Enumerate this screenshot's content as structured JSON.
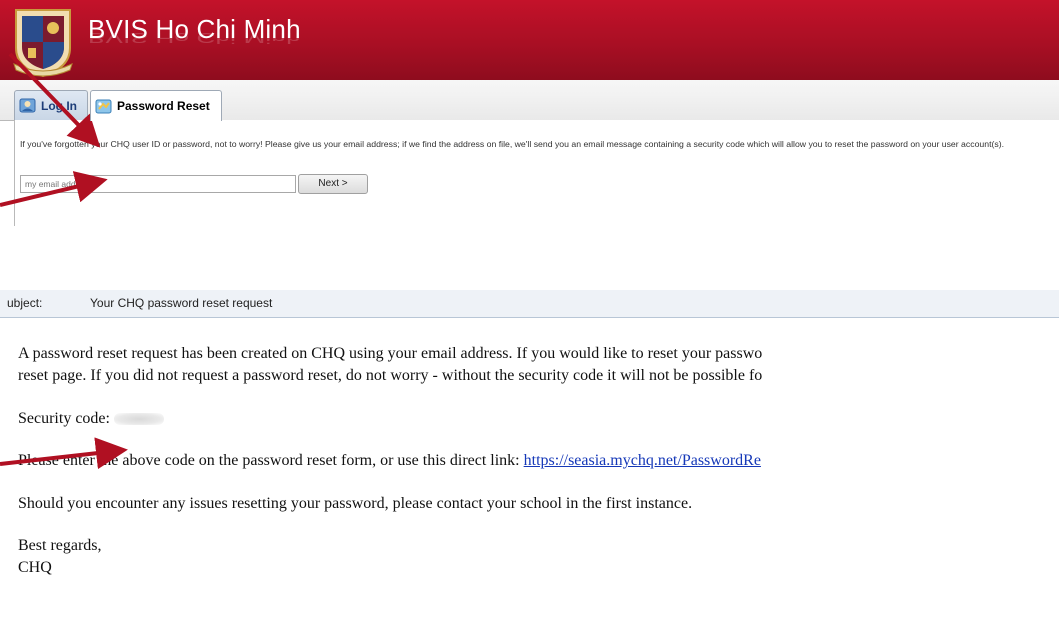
{
  "portal": {
    "title": "BVIS Ho Chi Minh",
    "title_reflection": "BVIS Ho Chi Minh",
    "tabs": [
      {
        "label": "Log In",
        "active": false
      },
      {
        "label": "Password Reset",
        "active": true
      }
    ],
    "instructions": "If you've forgotten your CHQ user ID or password, not to worry! Please give us your email address; if we find the address on file, we'll send you an email message containing a security code which will allow you to reset the password on your user account(s).",
    "email_input": {
      "placeholder": "my email address",
      "value": ""
    },
    "next_button": "Next >",
    "colors": {
      "banner": "#a90f24",
      "tab_active": "#ffffff"
    }
  },
  "email": {
    "subject_label": "ubject:",
    "subject": "Your CHQ password reset request",
    "line1": "A password reset request has been created on CHQ using your email address. If you would like to reset your passwo",
    "line2": "reset page. If you did not request a password reset, do not worry - without the security code it will not be possible fo",
    "security_label": "Security code:",
    "link_prefix": "Please enter the above code on the password reset form, or use this direct link: ",
    "link": "https://seasia.mychq.net/PasswordRe",
    "support": "Should you encounter any issues resetting your password, please contact your school in the first instance.",
    "regards": "Best regards,",
    "signature": "CHQ"
  },
  "annotations": {
    "arrow_color": "#b01022",
    "arrow_count": 3
  }
}
